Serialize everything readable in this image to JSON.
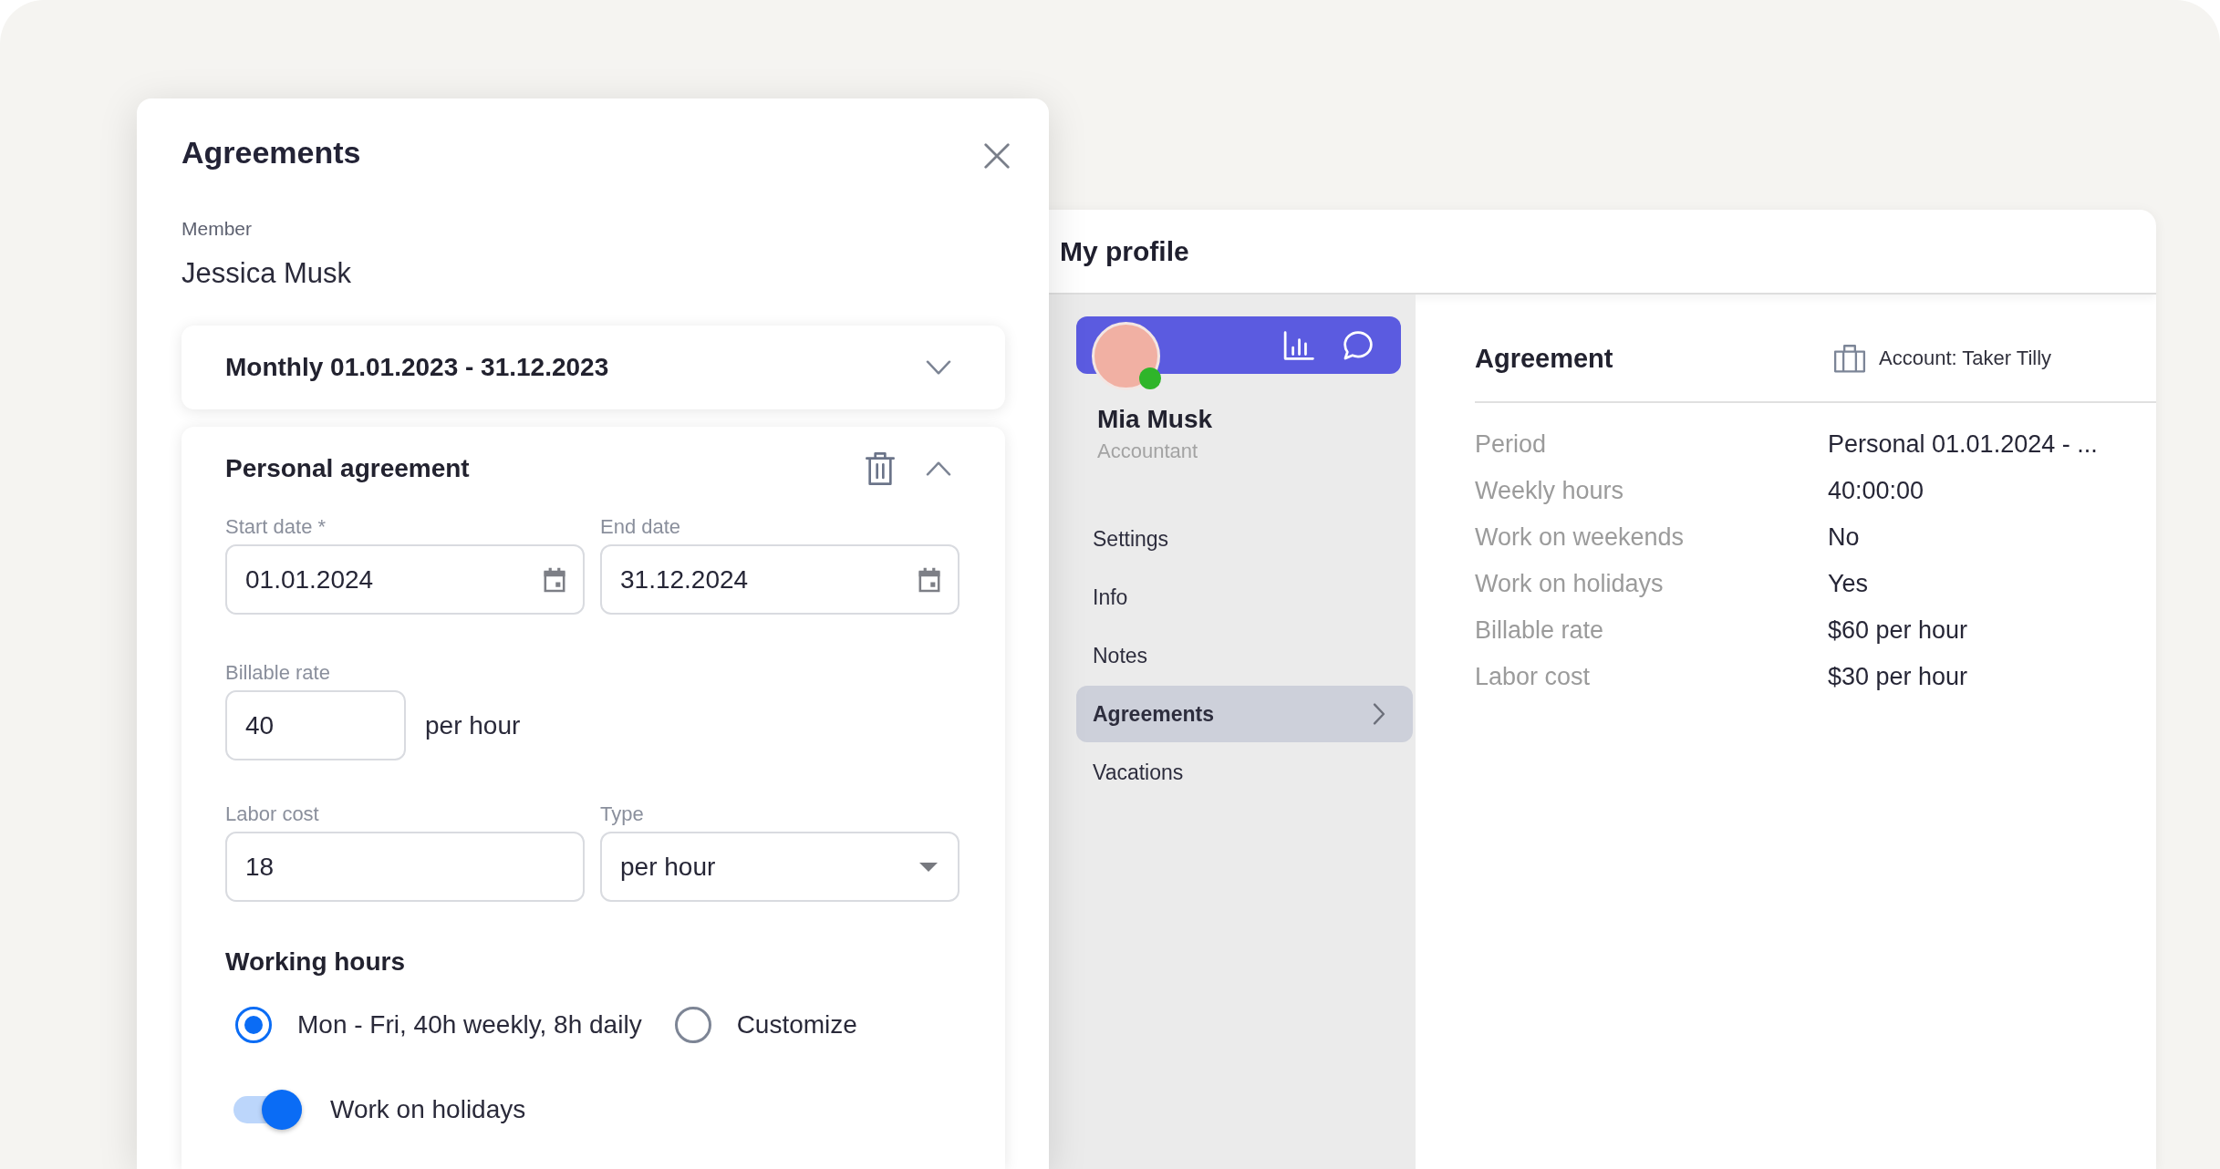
{
  "modal": {
    "title": "Agreements",
    "member": {
      "label": "Member",
      "name": "Jessica Musk"
    },
    "agreements": [
      {
        "title": "Monthly 01.01.2023 - 31.12.2023",
        "expanded": false
      },
      {
        "title": "Personal agreement",
        "expanded": true,
        "form": {
          "start_date": {
            "label": "Start date *",
            "value": "01.01.2024"
          },
          "end_date": {
            "label": "End date",
            "value": "31.12.2024"
          },
          "billable_rate": {
            "label": "Billable rate",
            "value": "40",
            "unit": "per hour"
          },
          "labor_cost": {
            "label": "Labor cost",
            "value": "18"
          },
          "type": {
            "label": "Type",
            "value": "per hour"
          },
          "working_hours": {
            "title": "Working hours",
            "options": [
              {
                "label": "Mon - Fri, 40h weekly, 8h daily",
                "selected": true
              },
              {
                "label": "Customize",
                "selected": false
              }
            ]
          },
          "work_on_holidays": {
            "label": "Work on holidays",
            "on": true
          }
        }
      }
    ]
  },
  "profile": {
    "title": "My profile",
    "user": {
      "name": "Mia Musk",
      "role": "Accountant",
      "online": true
    },
    "nav": [
      {
        "label": "Settings",
        "selected": false
      },
      {
        "label": "Info",
        "selected": false
      },
      {
        "label": "Notes",
        "selected": false
      },
      {
        "label": "Agreements",
        "selected": true
      },
      {
        "label": "Vacations",
        "selected": false
      }
    ],
    "agreement": {
      "title": "Agreement",
      "account": "Account: Taker Tilly",
      "rows": [
        {
          "label": "Period",
          "value": "Personal 01.01.2024 - ..."
        },
        {
          "label": "Weekly hours",
          "value": "40:00:00"
        },
        {
          "label": "Work on weekends",
          "value": "No"
        },
        {
          "label": "Work on holidays",
          "value": "Yes"
        },
        {
          "label": "Billable rate",
          "value": "$60 per hour"
        },
        {
          "label": "Labor cost",
          "value": "$30 per hour"
        }
      ]
    }
  }
}
